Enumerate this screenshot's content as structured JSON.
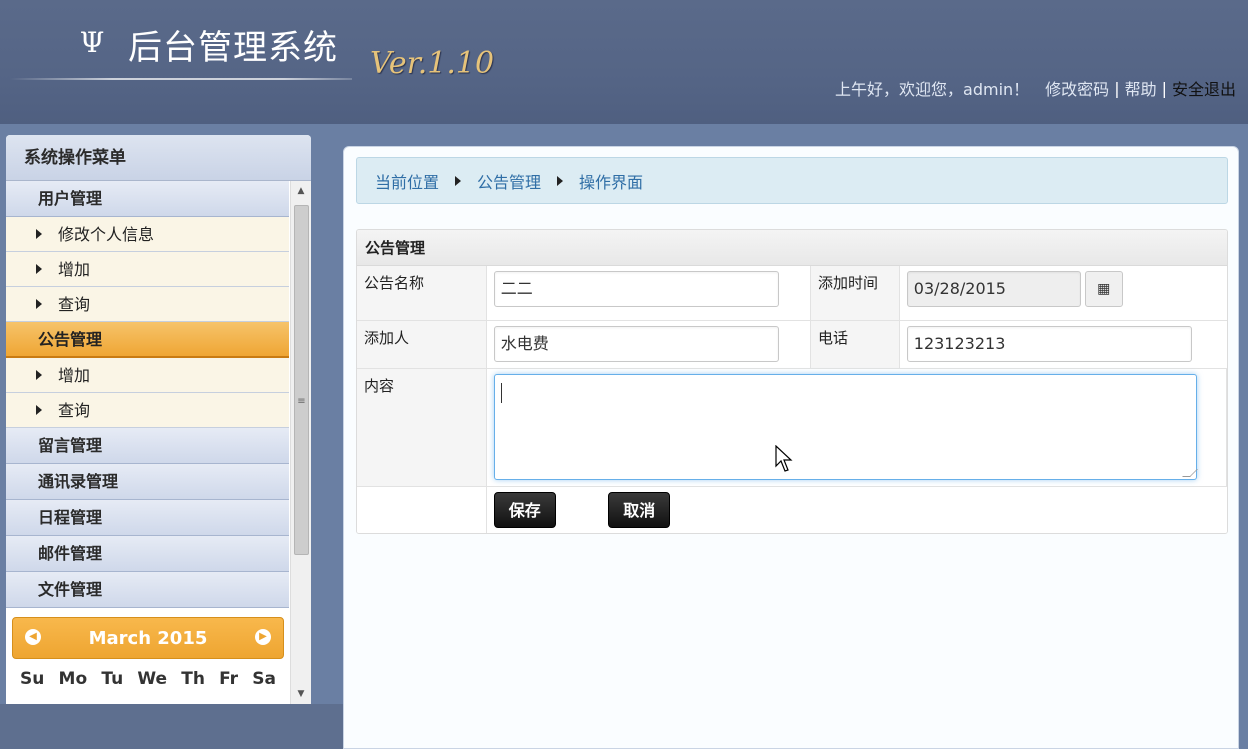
{
  "header": {
    "logo_icon": "Ψ",
    "title": "后台管理系统",
    "version": "Ver.1.10",
    "greeting": "上午好，欢迎您，admin！",
    "links": {
      "change_password": "修改密码",
      "help": "帮助",
      "logout": "安全退出",
      "separator": "|"
    }
  },
  "sidebar": {
    "title": "系统操作菜单",
    "groups": [
      {
        "label": "用户管理",
        "items": [
          "修改个人信息",
          "增加",
          "查询"
        ]
      },
      {
        "label": "公告管理",
        "active": true,
        "items": [
          "增加",
          "查询"
        ]
      },
      {
        "label": "留言管理"
      },
      {
        "label": "通讯录管理"
      },
      {
        "label": "日程管理"
      },
      {
        "label": "邮件管理"
      },
      {
        "label": "文件管理"
      }
    ],
    "calendar": {
      "title": "March 2015",
      "days": [
        "Su",
        "Mo",
        "Tu",
        "We",
        "Th",
        "Fr",
        "Sa"
      ]
    }
  },
  "breadcrumb": [
    "当前位置",
    "公告管理",
    "操作界面"
  ],
  "form": {
    "caption": "公告管理",
    "fields": {
      "name_label": "公告名称",
      "name_value": "二二",
      "time_label": "添加时间",
      "time_value": "03/28/2015",
      "adder_label": "添加人",
      "adder_value": "水电费",
      "phone_label": "电话",
      "phone_value": "123123213",
      "content_label": "内容",
      "content_value": ""
    },
    "buttons": {
      "save": "保存",
      "cancel": "取消"
    }
  },
  "colors": {
    "header_bg": "#556586",
    "active_menu": "#efa634",
    "version_text": "#e6c37a",
    "breadcrumb_text": "#2f6ea6",
    "button_bg": "#111111"
  },
  "icons": {
    "calendar_button": "calendar-icon",
    "calendar_prev": "chevron-left-icon",
    "calendar_next": "chevron-right-icon"
  }
}
